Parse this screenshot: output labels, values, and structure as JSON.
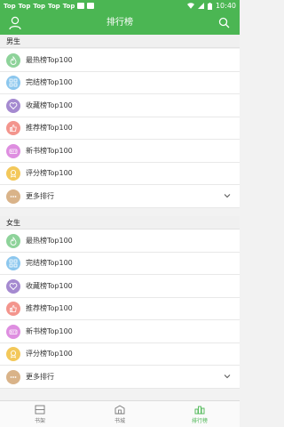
{
  "status_bar": {
    "left_labels": [
      "Top",
      "Top",
      "Top",
      "Top",
      "Top"
    ],
    "time": "10:40"
  },
  "app_bar": {
    "title": "排行榜"
  },
  "sections": [
    {
      "title": "男生",
      "items": [
        {
          "label": "最热榜Top100",
          "color": "#8ed39a",
          "icon": "fire-icon"
        },
        {
          "label": "完结榜Top100",
          "color": "#8cc7ee",
          "icon": "grid-icon"
        },
        {
          "label": "收藏榜Top100",
          "color": "#a58ad0",
          "icon": "heart-icon"
        },
        {
          "label": "推荐榜Top100",
          "color": "#f3958d",
          "icon": "thumb-up-icon"
        },
        {
          "label": "新书榜Top100",
          "color": "#de8ee0",
          "icon": "new-icon"
        },
        {
          "label": "评分榜Top100",
          "color": "#f3c85a",
          "icon": "medal-icon"
        },
        {
          "label": "更多排行",
          "color": "#d9b389",
          "icon": "more-icon"
        }
      ]
    },
    {
      "title": "女生",
      "items": [
        {
          "label": "最热榜Top100",
          "color": "#8ed39a",
          "icon": "fire-icon"
        },
        {
          "label": "完结榜Top100",
          "color": "#8cc7ee",
          "icon": "grid-icon"
        },
        {
          "label": "收藏榜Top100",
          "color": "#a58ad0",
          "icon": "heart-icon"
        },
        {
          "label": "推荐榜Top100",
          "color": "#f3958d",
          "icon": "thumb-up-icon"
        },
        {
          "label": "新书榜Top100",
          "color": "#de8ee0",
          "icon": "new-icon"
        },
        {
          "label": "评分榜Top100",
          "color": "#f3c85a",
          "icon": "medal-icon"
        },
        {
          "label": "更多排行",
          "color": "#d9b389",
          "icon": "more-icon"
        }
      ]
    }
  ],
  "tab_bar": {
    "tabs": [
      {
        "label": "书架",
        "icon": "bookshelf-icon",
        "active": false
      },
      {
        "label": "书城",
        "icon": "store-icon",
        "active": false
      },
      {
        "label": "排行榜",
        "icon": "ranking-icon",
        "active": true
      }
    ],
    "active_color": "#4bb653"
  },
  "theme": {
    "primary": "#4bb653"
  }
}
